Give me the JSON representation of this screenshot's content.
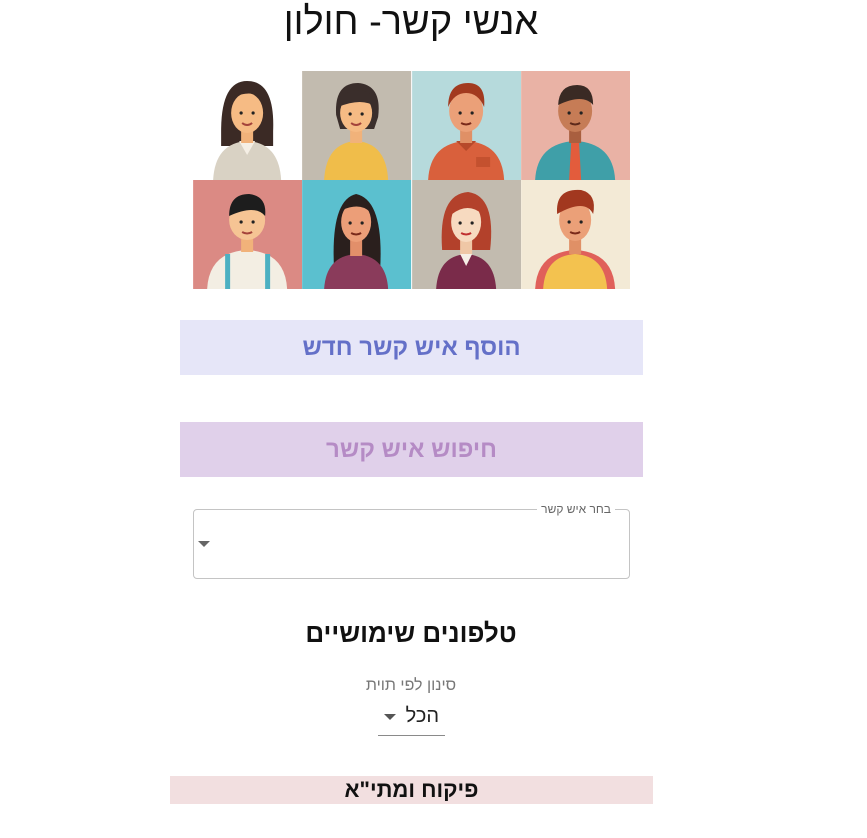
{
  "header": {
    "title": "אנשי קשר- חולון"
  },
  "avatars": [
    {
      "name": "avatar-woman-dark-hair",
      "bg": "#ffffff"
    },
    {
      "name": "avatar-woman-yellow-sweater",
      "bg": "#c2bbaf"
    },
    {
      "name": "avatar-man-orange-shirt",
      "bg": "#b6dadc"
    },
    {
      "name": "avatar-man-teal-shirt-tie",
      "bg": "#e9b2a5"
    },
    {
      "name": "avatar-man-suspenders",
      "bg": "#db8a84"
    },
    {
      "name": "avatar-woman-long-hair",
      "bg": "#5bc0cf"
    },
    {
      "name": "avatar-woman-red-hair",
      "bg": "#c2bbaf"
    },
    {
      "name": "avatar-man-yellow-vest",
      "bg": "#f3ead6"
    }
  ],
  "actions": {
    "add_contact_label": "הוסף איש קשר חדש",
    "search_contact_label": "חיפוש איש קשר"
  },
  "contact_select": {
    "label": "בחר איש קשר",
    "value": ""
  },
  "useful_phones": {
    "title": "טלפונים שימושיים",
    "filter_label": "סינון לפי תוית",
    "filter_value": "הכל",
    "first_category": "פיקוח ומתי\"א"
  },
  "colors": {
    "add_bg": "#e6e6f8",
    "add_text": "#6470c8",
    "search_bg": "#e0d0ea",
    "search_text": "#b58bc5",
    "category_bg": "#f2dfe0"
  }
}
